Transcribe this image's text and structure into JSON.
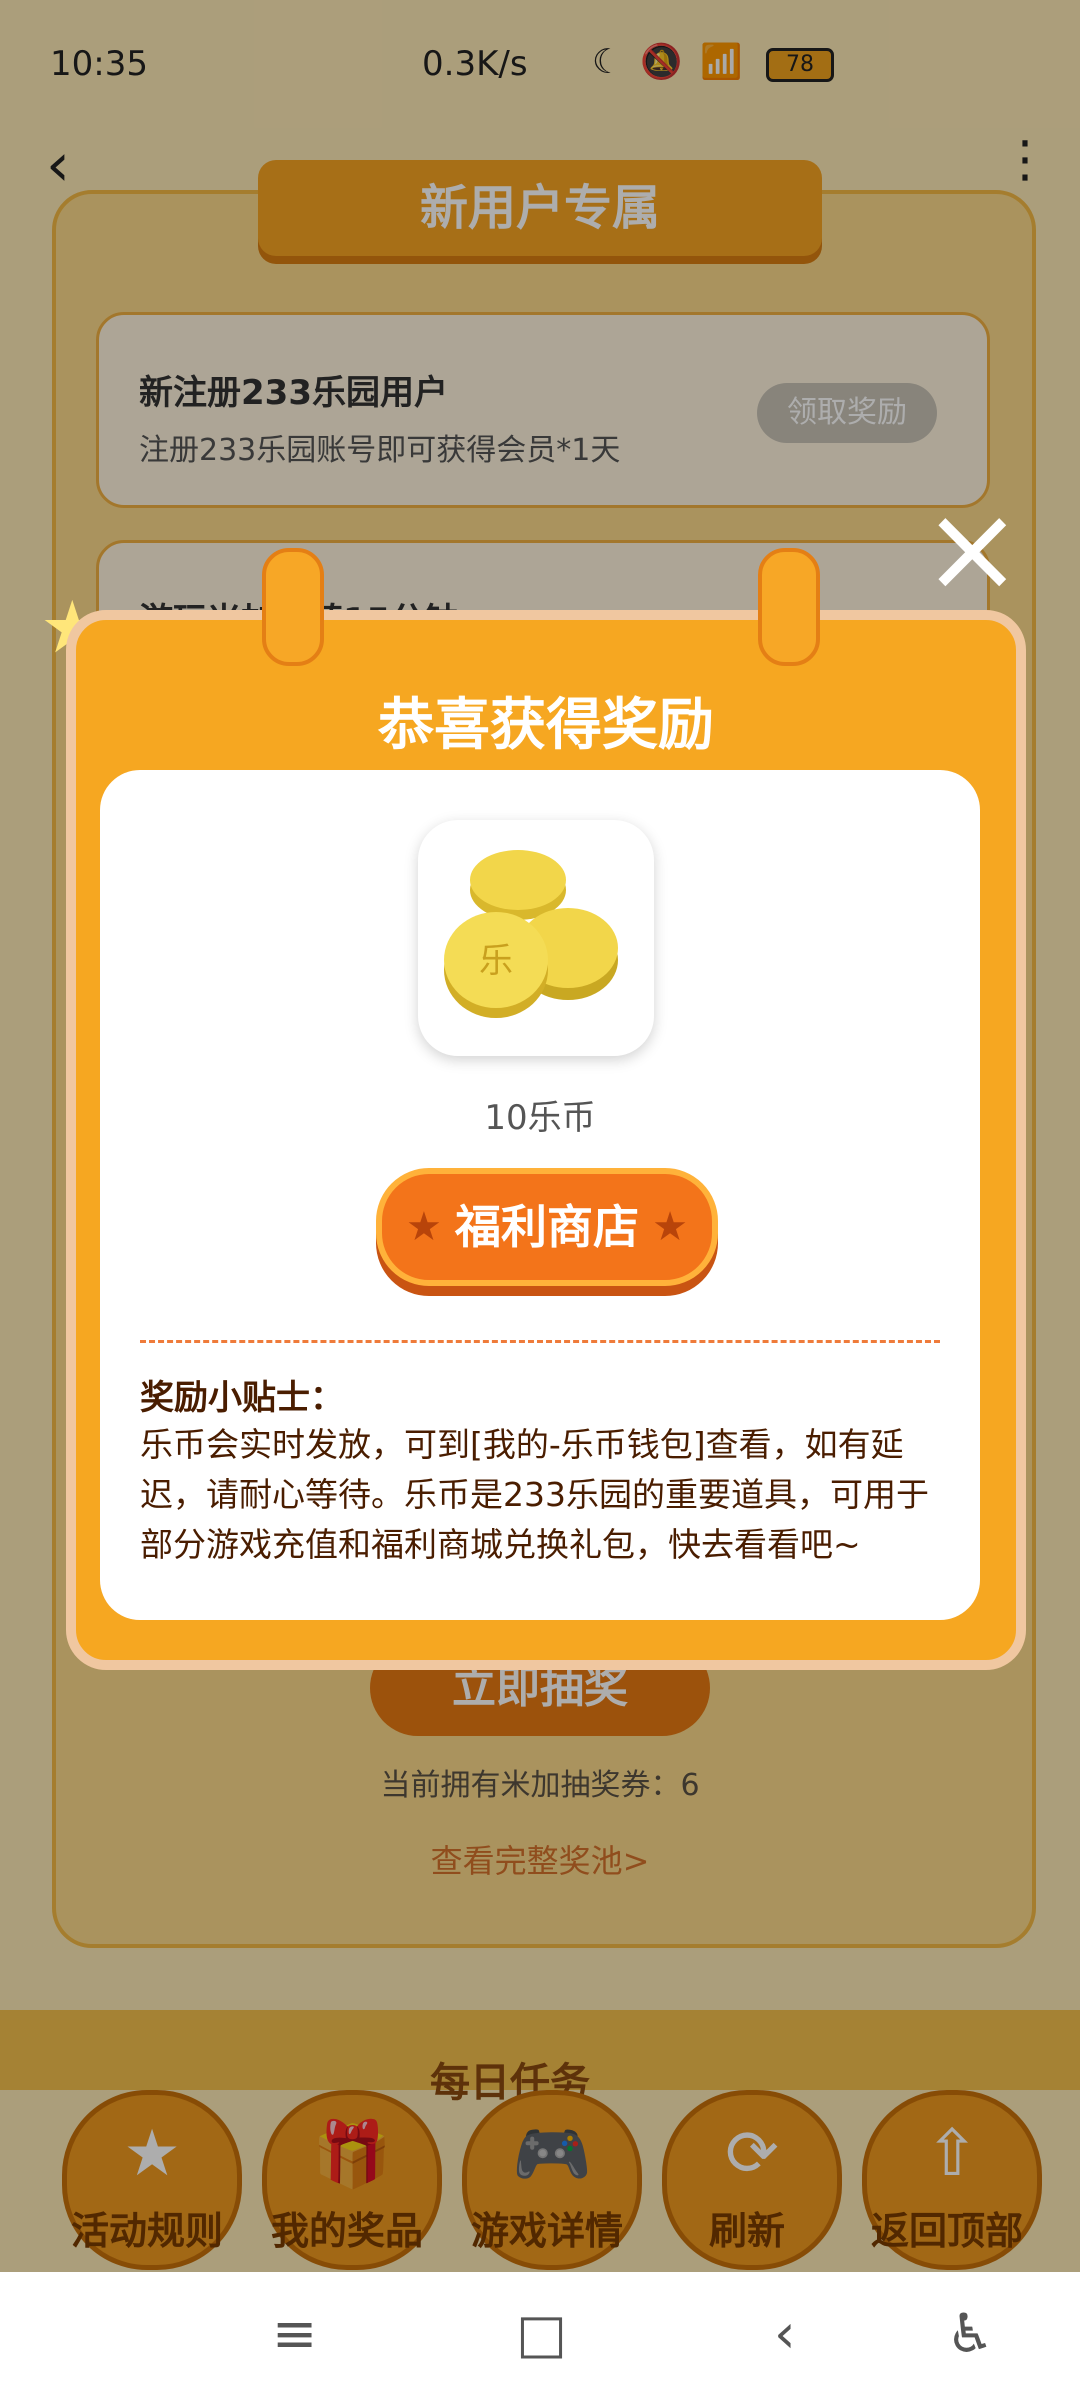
{
  "status_bar": {
    "time": "10:35",
    "network_speed": "0.3K/s",
    "battery": "78"
  },
  "header": {
    "title": "新用户专属"
  },
  "tasks": [
    {
      "title": "新注册233乐园用户",
      "desc": "注册233乐园账号即可获得会员*1天",
      "button": "领取奖励"
    },
    {
      "title": "游玩米加小镇15分钟"
    }
  ],
  "draw_section": {
    "button": "立即抽奖",
    "tickets": "当前拥有米加抽奖券：6",
    "pool_link": "查看完整奖池>"
  },
  "nav_section_title": "每日任务",
  "bottom_nav": [
    {
      "label": "活动规则",
      "icon": "rules-icon"
    },
    {
      "label": "我的奖品",
      "icon": "gift-icon"
    },
    {
      "label": "游戏详情",
      "icon": "gamepad-icon"
    },
    {
      "label": "刷新",
      "icon": "refresh-icon"
    },
    {
      "label": "返回顶部",
      "icon": "back-to-top-icon"
    }
  ],
  "modal": {
    "title": "恭喜获得奖励",
    "reward_label": "10乐币",
    "shop_button": "福利商店",
    "tips_title": "奖励小贴士：",
    "tips_text": "乐币会实时发放，可到[我的-乐币钱包]查看，如有延迟，请耐心等待。乐币是233乐园的重要道具，可用于部分游戏充值和福利商城兑换礼包，快去看看吧~"
  },
  "colors": {
    "accent": "#f6a721",
    "button_orange": "#f3741a",
    "text_dark": "#4a1d00"
  }
}
